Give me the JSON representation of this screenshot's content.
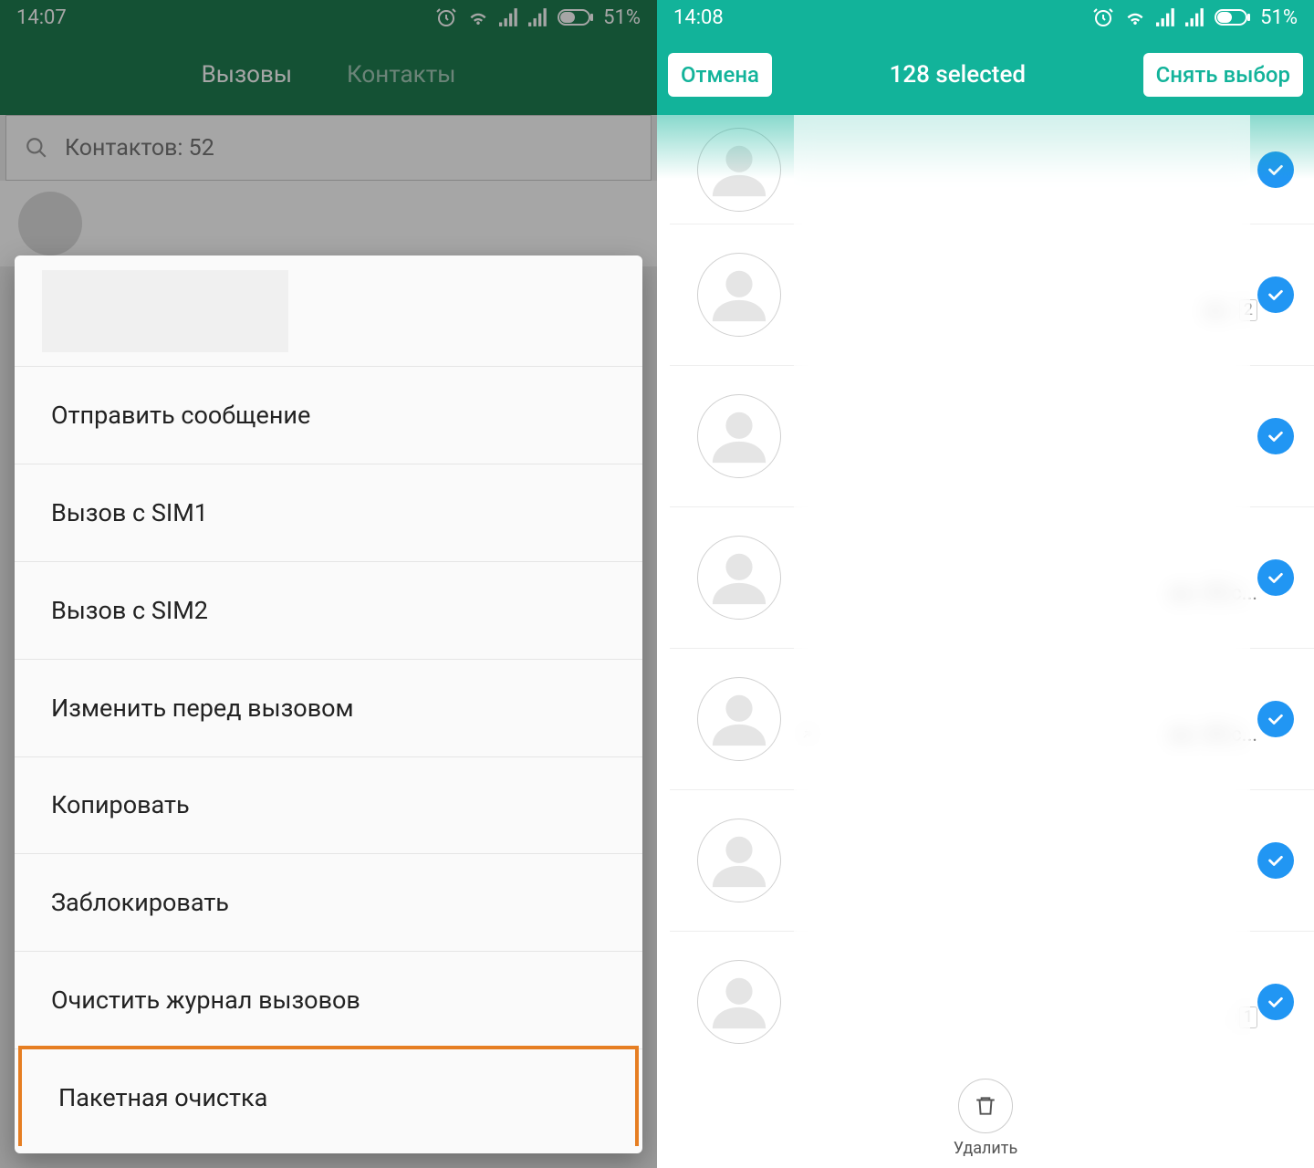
{
  "left": {
    "status": {
      "time": "14:07",
      "battery": "51%"
    },
    "tabs": {
      "calls": "Вызовы",
      "contacts": "Контакты"
    },
    "search_placeholder": "Контактов: 52",
    "menu": {
      "send_message": "Отправить сообщение",
      "call_sim1": "Вызов с SIM1",
      "call_sim2": "Вызов с SIM2",
      "edit_before_call": "Изменить перед вызовом",
      "copy": "Копировать",
      "block": "Заблокировать",
      "clear_call_log": "Очистить журнал вызовов",
      "batch_delete": "Пакетная очистка"
    }
  },
  "right": {
    "status": {
      "time": "14:08",
      "battery": "51%"
    },
    "header": {
      "cancel": "Отмена",
      "title": "128 selected",
      "deselect": "Снять выбор"
    },
    "rows": [
      {
        "detail": "",
        "badge": ""
      },
      {
        "detail": "ек.",
        "badge": "2"
      },
      {
        "detail": "",
        "badge": ""
      },
      {
        "detail": "ин. 35 с...",
        "badge": ""
      },
      {
        "detail": "ин. 43 с...",
        "badge": ""
      },
      {
        "detail": "",
        "badge": ""
      },
      {
        "detail": ".",
        "badge": "1"
      }
    ],
    "bottom": {
      "delete": "Удалить"
    }
  }
}
